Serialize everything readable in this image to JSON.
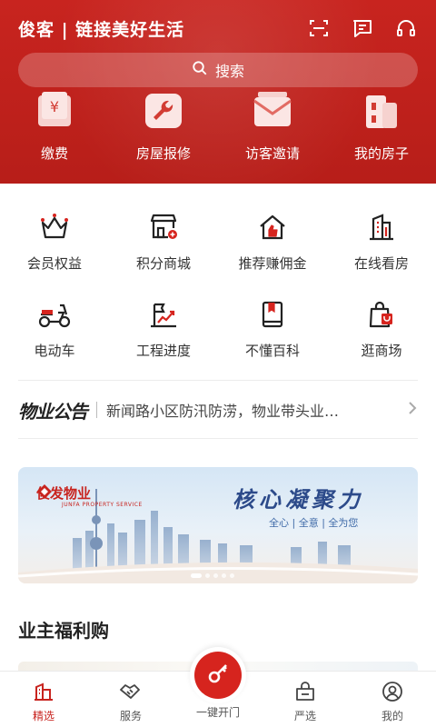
{
  "header": {
    "app_title": "俊客 | 链接美好生活",
    "actions": [
      {
        "icon": "scan-icon"
      },
      {
        "icon": "message-icon"
      },
      {
        "icon": "headset-icon"
      }
    ]
  },
  "search": {
    "placeholder": "搜索",
    "icon": "search-icon"
  },
  "quick_actions": [
    {
      "label": "缴费",
      "icon": "payment-icon"
    },
    {
      "label": "房屋报修",
      "icon": "wrench-icon"
    },
    {
      "label": "访客邀请",
      "icon": "invitation-icon"
    },
    {
      "label": "我的房子",
      "icon": "building-icon"
    }
  ],
  "services": [
    {
      "label": "会员权益",
      "icon": "crown-icon"
    },
    {
      "label": "积分商城",
      "icon": "store-icon"
    },
    {
      "label": "推荐赚佣金",
      "icon": "house-thumb-icon"
    },
    {
      "label": "在线看房",
      "icon": "tower-icon"
    },
    {
      "label": "电动车",
      "icon": "scooter-icon"
    },
    {
      "label": "工程进度",
      "icon": "progress-flag-icon"
    },
    {
      "label": "不懂百科",
      "icon": "book-icon"
    },
    {
      "label": "逛商场",
      "icon": "shopping-bag-icon"
    }
  ],
  "notice": {
    "tag": "物业公告",
    "text": "新闻路小区防汛防涝，物业带头业…"
  },
  "banner": {
    "brand": "俊发物业",
    "brand_sub": "JUNFA PROPERTY SERVICE",
    "slogan": "核心凝聚力",
    "subtitle": "全心 | 全意 | 全为您"
  },
  "section": {
    "title": "业主福利购"
  },
  "tabbar": {
    "tabs": [
      {
        "label": "精选",
        "icon": "featured-icon",
        "active": true
      },
      {
        "label": "服务",
        "icon": "handshake-icon",
        "active": false
      },
      {
        "label": "一键开门",
        "icon": "key-icon",
        "active": false
      },
      {
        "label": "严选",
        "icon": "select-bag-icon",
        "active": false
      },
      {
        "label": "我的",
        "icon": "profile-icon",
        "active": false
      }
    ]
  },
  "colors": {
    "brand_red": "#c8241f",
    "text": "#333333",
    "divider": "#ececec"
  }
}
